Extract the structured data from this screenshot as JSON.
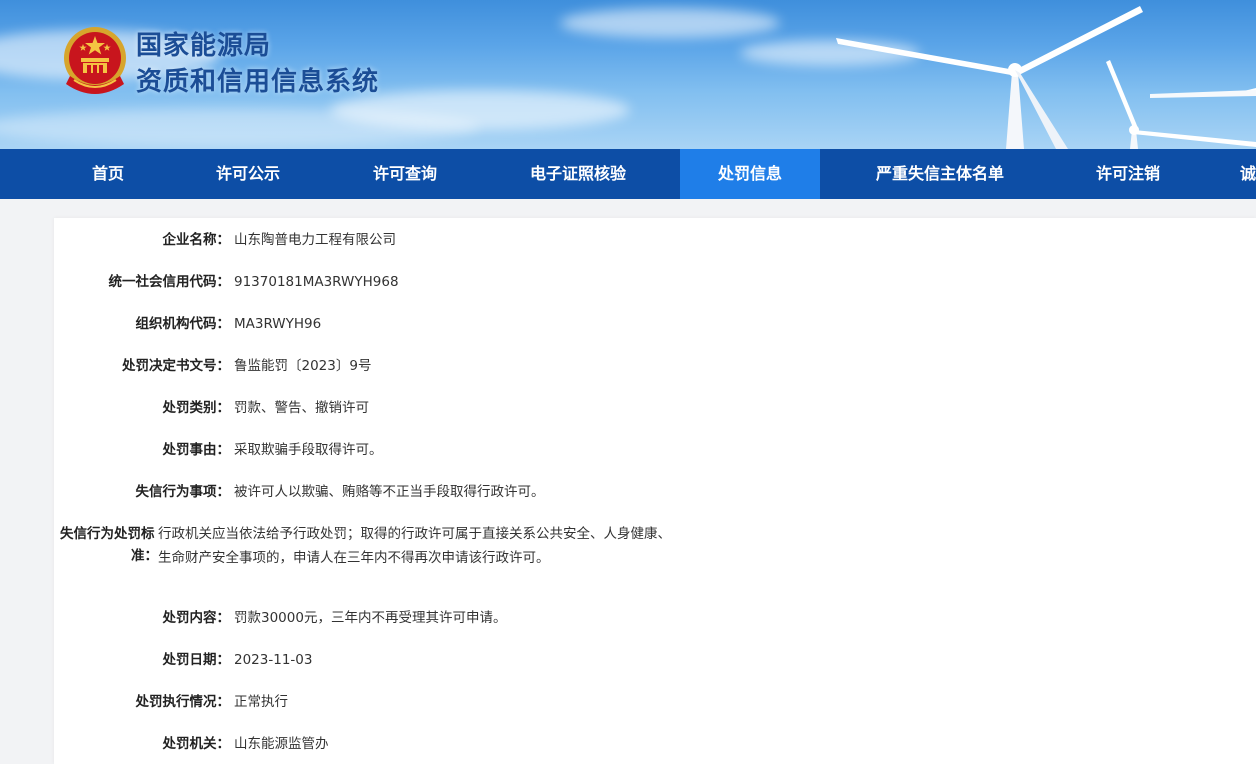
{
  "header": {
    "title_line1": "国家能源局",
    "title_line2": "资质和信用信息系统"
  },
  "nav": {
    "items": [
      "首页",
      "许可公示",
      "许可查询",
      "电子证照核验",
      "处罚信息",
      "严重失信主体名单",
      "许可注销",
      "诚"
    ],
    "active": "处罚信息"
  },
  "detail": {
    "company_name": {
      "label": "企业名称：",
      "value": "山东陶普电力工程有限公司"
    },
    "credit_code": {
      "label": "统一社会信用代码：",
      "value": "91370181MA3RWYH968"
    },
    "org_code": {
      "label": "组织机构代码：",
      "value": "MA3RWYH96"
    },
    "decision_no": {
      "label": "处罚决定书文号：",
      "value": "鲁监能罚〔2023〕9号"
    },
    "penalty_type": {
      "label": "处罚类别：",
      "value": "罚款、警告、撤销许可"
    },
    "penalty_reason": {
      "label": "处罚事由：",
      "value": "采取欺骗手段取得许可。"
    },
    "dishonest_item": {
      "label": "失信行为事项：",
      "value": "被许可人以欺骗、贿赂等不正当手段取得行政许可。"
    },
    "dishonest_standard": {
      "label_line1": "失信行为处罚标",
      "label_line2": "准：",
      "value_line1": "行政机关应当依法给予行政处罚；取得的行政许可属于直接关系公共安全、人身健康、",
      "value_line2": "生命财产安全事项的，申请人在三年内不得再次申请该行政许可。"
    },
    "penalty_content": {
      "label": "处罚内容：",
      "value": "罚款30000元，三年内不再受理其许可申请。"
    },
    "penalty_date": {
      "label": "处罚日期：",
      "value": "2023-11-03"
    },
    "execution_status": {
      "label": "处罚执行情况：",
      "value": "正常执行"
    },
    "penalty_authority": {
      "label": "处罚机关：",
      "value": "山东能源监管办"
    }
  },
  "colors": {
    "nav_bg": "#0d4ea6",
    "nav_active_bg": "#1f7ee8",
    "title_color": "#1b4d96"
  },
  "icons": {
    "emblem": "national-emblem-icon",
    "turbines": "wind-turbine-illustration"
  }
}
